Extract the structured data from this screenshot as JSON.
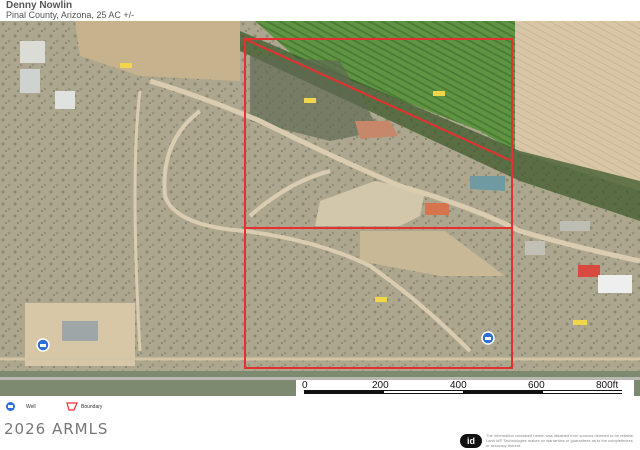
{
  "header": {
    "title": "Denny Nowlin",
    "subtitle": "Pinal County, Arizona, 25 AC +/-"
  },
  "colors": {
    "boundary": "#e53030",
    "well": "#2c6fd6",
    "desert": "#b9ad93",
    "field": "#5b8f3e",
    "dirt_road": "#d9ccb0"
  },
  "scale": {
    "labels": [
      "0",
      "200",
      "400",
      "600",
      "800ft"
    ]
  },
  "legend": {
    "well_label": "Well",
    "boundary_label": "Boundary"
  },
  "footer": {
    "copyright": "2026 ARMLS",
    "logo_text": "id",
    "disclaimer": "The information contained herein was obtained from sources deemed to be reliable. Land Id® Technologies makes no warranties or guarantees as to the completeness or accuracy thereof."
  }
}
